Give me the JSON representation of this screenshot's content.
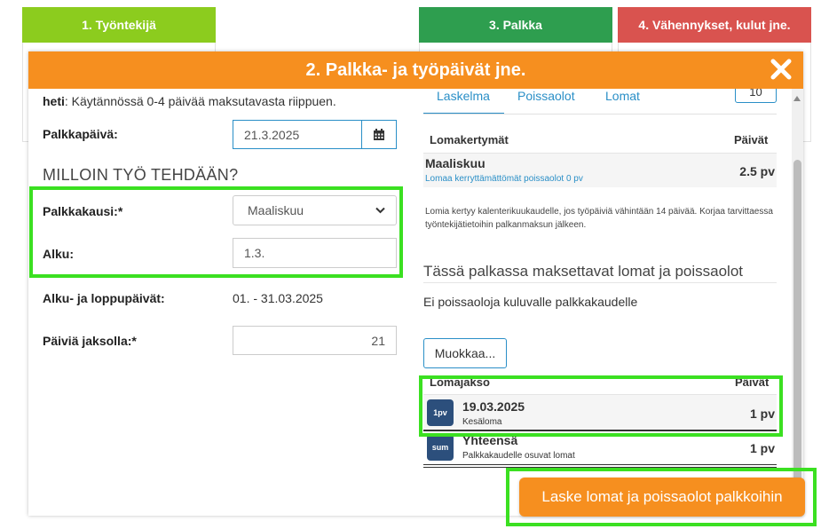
{
  "steps": {
    "step1": "1. Työntekijä",
    "step3": "3. Palkka",
    "step4": "4. Vähennykset, kulut jne."
  },
  "modal": {
    "title": "2. Palkka- ja työpäivät jne."
  },
  "left": {
    "info_bold": "heti",
    "info_text": ": Käytännössä 0-4 päivää maksutavasta riippuen.",
    "payday_label": "Palkkapäivä:",
    "payday_value": "21.3.2025",
    "section_heading": "MILLOIN TYÖ TEHDÄÄN?",
    "period_label": "Palkkakausi:*",
    "period_value": "Maaliskuu",
    "start_label": "Alku:",
    "start_value": "1.3.",
    "range_label": "Alku- ja loppupäivät:",
    "range_value": "01. - 31.03.2025",
    "days_label": "Päiviä jaksolla:*",
    "days_value": "21"
  },
  "right": {
    "tabs": [
      "Laskelma",
      "Poissaolot",
      "Lomat"
    ],
    "top_button": " 10",
    "accrual_header": "Lomakertymät",
    "days_header": "Päivät",
    "accrual_month": "Maaliskuu",
    "accrual_days": "2.5 pv",
    "accrual_sub": "Lomaa kerryttämättömät poissaolot 0 pv",
    "note": "Lomia kertyy kalenterikuukaudelle, jos työpäiviä vähintään 14 päivää. Korjaa tarvittaessa työntekijätietoihin palkanmaksun jälkeen.",
    "paid_heading": "Tässä palkassa maksettavat lomat ja poissaolot",
    "no_absences": "Ei poissaoloja kuluvalle palkkakaudelle",
    "edit_button": "Muokkaa...",
    "period_header": "Lomajakso",
    "period_days_header": "Päivät",
    "row1_badge": "1pv",
    "row1_date": "19.03.2025",
    "row1_sub": "Kesäloma",
    "row1_days": "1 pv",
    "row2_badge": "sum",
    "row2_title": "Yhteensä",
    "row2_sub": "Palkkakaudelle osuvat lomat",
    "row2_days": "1 pv"
  },
  "action_button": "Laske lomat ja poissaolot palkkoihin",
  "colors": {
    "orange": "#f68f1f",
    "green_step": "#8ccc1e",
    "dark_green_step": "#2e9e4f",
    "red_step": "#d9534f",
    "highlight": "#3be021",
    "link_blue": "#2a8fc7"
  }
}
